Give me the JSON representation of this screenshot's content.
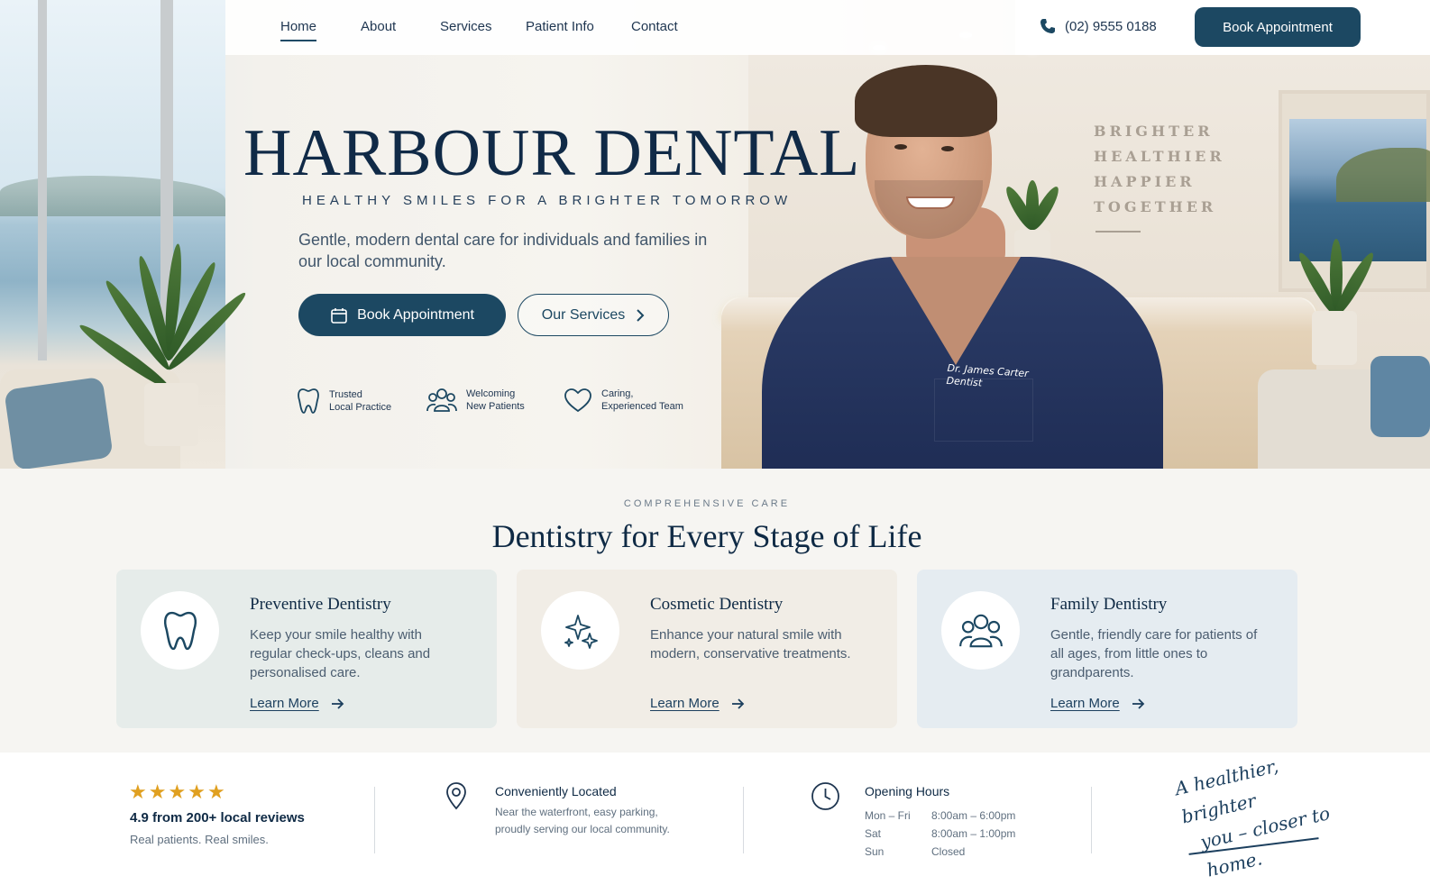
{
  "nav": {
    "items": [
      {
        "label": "Home",
        "active": true
      },
      {
        "label": "About"
      },
      {
        "label": "Services"
      },
      {
        "label": "Patient Info"
      },
      {
        "label": "Contact"
      }
    ],
    "phone": "(02) 9555 0188",
    "book_label": "Book Appointment"
  },
  "hero": {
    "title": "HARBOUR DENTAL",
    "tagline": "HEALTHY SMILES FOR A BRIGHTER TOMORROW",
    "description": "Gentle, modern dental care for individuals and families in our local community.",
    "primary_button": "Book Appointment",
    "secondary_button": "Our Services",
    "features": [
      {
        "icon": "tooth-icon",
        "line1": "Trusted",
        "line2": "Local Practice"
      },
      {
        "icon": "people-icon",
        "line1": "Welcoming",
        "line2": "New Patients"
      },
      {
        "icon": "heart-icon",
        "line1": "Caring,",
        "line2": "Experienced Team"
      }
    ],
    "wall_text": [
      "BRIGHTER",
      "HEALTHIER",
      "HAPPIER",
      "TOGETHER"
    ],
    "doctor_badge": {
      "name": "Dr. James Carter",
      "role": "Dentist"
    }
  },
  "services": {
    "eyebrow": "COMPREHENSIVE CARE",
    "title": "Dentistry for Every Stage of Life",
    "cards": [
      {
        "title": "Preventive Dentistry",
        "description": "Keep your smile healthy with regular check-ups, cleans and personalised care.",
        "link": "Learn More",
        "icon": "tooth-icon",
        "bg": "#e6ecea"
      },
      {
        "title": "Cosmetic Dentistry",
        "description": "Enhance your natural smile with modern, conservative treatments.",
        "link": "Learn More",
        "icon": "sparkle-icon",
        "bg": "#f1ede6"
      },
      {
        "title": "Family Dentistry",
        "description": "Gentle, friendly care for patients of all ages, from little ones to grandparents.",
        "link": "Learn More",
        "icon": "family-icon",
        "bg": "#e5ecf1"
      }
    ]
  },
  "info": {
    "rating": {
      "stars": 5,
      "headline": "4.9 from 200+ local reviews",
      "sub": "Real patients. Real smiles."
    },
    "location": {
      "title": "Conveniently Located",
      "line1": "Near the waterfront, easy parking,",
      "line2": "proudly serving our local community."
    },
    "hours": {
      "title": "Opening Hours",
      "rows": [
        {
          "day": "Mon – Fri",
          "time": "8:00am – 6:00pm"
        },
        {
          "day": "Sat",
          "time": "8:00am – 1:00pm"
        },
        {
          "day": "Sun",
          "time": "Closed"
        }
      ]
    },
    "tagline_line1": "A healthier, brighter",
    "tagline_line2": "you – closer to home."
  },
  "colors": {
    "primary": "#1c4862",
    "navy": "#0f2a45",
    "star": "#e0a020"
  }
}
